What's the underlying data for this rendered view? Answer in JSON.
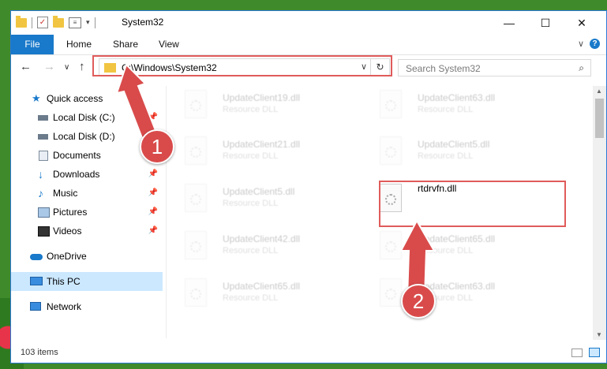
{
  "window": {
    "title": "System32",
    "minimize_glyph": "—",
    "maximize_glyph": "☐",
    "close_glyph": "✕"
  },
  "ribbon": {
    "tabs": [
      "File",
      "Home",
      "Share",
      "View"
    ],
    "collapse_glyph": "∨",
    "help_glyph": "?"
  },
  "navigation": {
    "back_glyph": "←",
    "forward_glyph": "→",
    "recent_glyph": "∨",
    "up_glyph": "↑",
    "address": "C:\\Windows\\System32",
    "address_dropdown_glyph": "∨",
    "refresh_glyph": "↻",
    "search_placeholder": "Search System32",
    "search_glyph": "⌕"
  },
  "sidebar": {
    "items": [
      {
        "label": "Quick access",
        "icon": "star-icon",
        "pinned": false
      },
      {
        "label": "Local Disk (C:)",
        "icon": "drive-icon",
        "pinned": true
      },
      {
        "label": "Local Disk (D:)",
        "icon": "drive-icon",
        "pinned": false
      },
      {
        "label": "Documents",
        "icon": "documents-icon",
        "pinned": false
      },
      {
        "label": "Downloads",
        "icon": "download-icon",
        "pinned": true
      },
      {
        "label": "Music",
        "icon": "music-icon",
        "pinned": true
      },
      {
        "label": "Pictures",
        "icon": "pictures-icon",
        "pinned": true
      },
      {
        "label": "Videos",
        "icon": "videos-icon",
        "pinned": true
      },
      {
        "label": "OneDrive",
        "icon": "cloud-icon",
        "pinned": false
      },
      {
        "label": "This PC",
        "icon": "computer-icon",
        "pinned": false
      },
      {
        "label": "Network",
        "icon": "network-icon",
        "pinned": false
      }
    ],
    "pin_glyph": "📌"
  },
  "files": [
    {
      "name": "UpdateClient19.dll",
      "type": "Resource DLL"
    },
    {
      "name": "UpdateClient63.dll",
      "type": "Resource DLL"
    },
    {
      "name": "UpdateClient21.dll",
      "type": "Resource DLL"
    },
    {
      "name": "UpdateClient5.dll",
      "type": "Resource DLL"
    },
    {
      "name": "UpdateClient5.dll",
      "type": "Resource DLL"
    },
    {
      "name": "rtdrvfn.dll",
      "type": ""
    },
    {
      "name": "UpdateClient42.dll",
      "type": "Resource DLL"
    },
    {
      "name": "UpdateClient65.dll",
      "type": "Resource DLL"
    },
    {
      "name": "UpdateClient65.dll",
      "type": "Resource DLL"
    },
    {
      "name": "UpdateClient63.dll",
      "type": "Resource DLL"
    }
  ],
  "status": {
    "item_count": "103 items"
  },
  "annotations": {
    "callout_1": "1",
    "callout_2": "2",
    "highlight_color": "#e05b5b"
  },
  "colors": {
    "accent": "#1979ca",
    "selected": "#cce8ff"
  }
}
